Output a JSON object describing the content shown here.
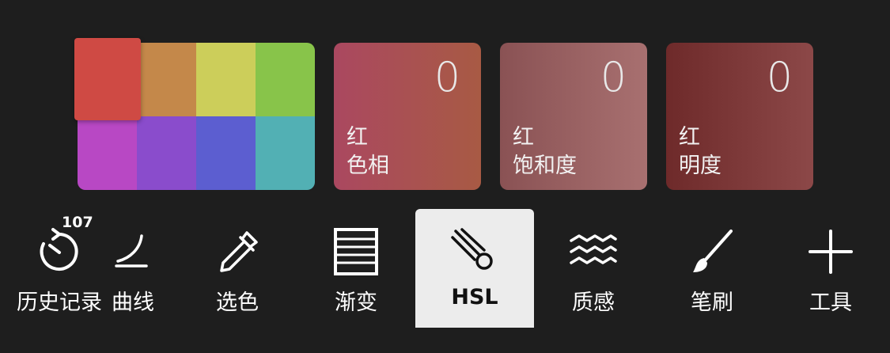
{
  "swatches": {
    "colors": [
      "#d4504a",
      "#c4884a",
      "#ccce5a",
      "#88c44a",
      "#b848c4",
      "#8a4ccc",
      "#5c5ed0",
      "#52b0b4"
    ],
    "selected_color": "#cf4a44"
  },
  "adjustments": [
    {
      "value": "0",
      "line1": "红",
      "line2": "色相",
      "gradient": [
        "#aa4860",
        "#a85a44"
      ]
    },
    {
      "value": "0",
      "line1": "红",
      "line2": "饱和度",
      "gradient": [
        "#8a5254",
        "#a87070"
      ]
    },
    {
      "value": "0",
      "line1": "红",
      "line2": "明度",
      "gradient": [
        "#6e2a2a",
        "#8c4848"
      ]
    }
  ],
  "toolbar": {
    "history_badge": "107",
    "tools": [
      {
        "label": "历史记录",
        "icon": "history-timer-icon"
      },
      {
        "label": "曲线",
        "icon": "curve-icon"
      },
      {
        "label": "选色",
        "icon": "eyedropper-icon"
      },
      {
        "label": "渐变",
        "icon": "gradient-lines-icon"
      },
      {
        "label": "HSL",
        "icon": "hsl-comet-icon"
      },
      {
        "label": "质感",
        "icon": "texture-waves-icon"
      },
      {
        "label": "笔刷",
        "icon": "brush-icon"
      },
      {
        "label": "工具",
        "icon": "plus-icon"
      }
    ]
  },
  "colors": {
    "background": "#1e1e1e",
    "active_tab_bg": "#ececec"
  }
}
